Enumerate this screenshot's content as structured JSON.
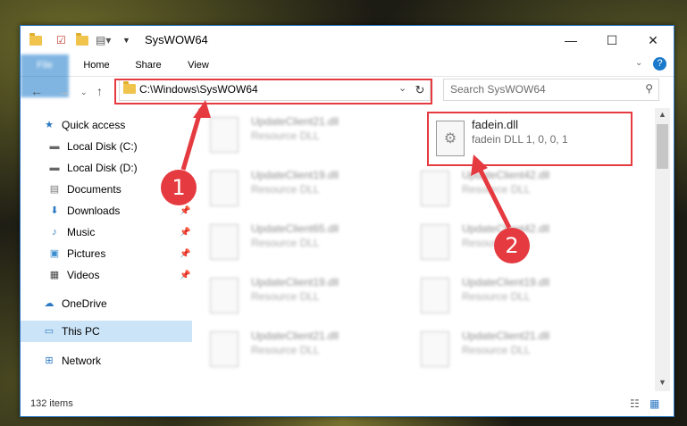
{
  "window": {
    "title": "SysWOW64"
  },
  "ribbon": {
    "tabs": [
      "File",
      "Home",
      "Share",
      "View"
    ]
  },
  "address": {
    "path": "C:\\Windows\\SysWOW64"
  },
  "search": {
    "placeholder": "Search SysWOW64"
  },
  "sidebar": {
    "items": [
      {
        "label": "Quick access",
        "icon": "star-icon",
        "pinned": false
      },
      {
        "label": "Local Disk (C:)",
        "icon": "drive-icon",
        "pinned": false
      },
      {
        "label": "Local Disk (D:)",
        "icon": "drive-icon",
        "pinned": false
      },
      {
        "label": "Documents",
        "icon": "documents-icon",
        "pinned": false
      },
      {
        "label": "Downloads",
        "icon": "download-icon",
        "pinned": true
      },
      {
        "label": "Music",
        "icon": "music-icon",
        "pinned": true
      },
      {
        "label": "Pictures",
        "icon": "pictures-icon",
        "pinned": true
      },
      {
        "label": "Videos",
        "icon": "videos-icon",
        "pinned": true
      },
      {
        "label": "OneDrive",
        "icon": "cloud-icon",
        "pinned": false
      },
      {
        "label": "This PC",
        "icon": "pc-icon",
        "pinned": false,
        "selected": true
      },
      {
        "label": "Network",
        "icon": "network-icon",
        "pinned": false
      }
    ]
  },
  "files": [
    {
      "name": "UpdateClient21.dll",
      "desc": "Resource DLL"
    },
    {
      "name": "UpdateClient19.dll",
      "desc": "Resource DLL"
    },
    {
      "name": "UpdateClient42.dll",
      "desc": "Resource DLL"
    },
    {
      "name": "UpdateClient65.dll",
      "desc": "Resource DLL"
    },
    {
      "name": "UpdateClient42.dll",
      "desc": "Resource DLL"
    },
    {
      "name": "UpdateClient19.dll",
      "desc": "Resource DLL"
    },
    {
      "name": "UpdateClient19.dll",
      "desc": "Resource DLL"
    },
    {
      "name": "UpdateClient21.dll",
      "desc": "Resource DLL"
    },
    {
      "name": "UpdateClient21.dll",
      "desc": "Resource DLL"
    }
  ],
  "selected_file": {
    "name": "fadein.dll",
    "desc": "fadein DLL 1, 0, 0, 1"
  },
  "status": {
    "count": "132 items"
  },
  "markers": [
    "1",
    "2"
  ],
  "colors": {
    "accent": "#1979ca",
    "highlight": "#e53a40"
  }
}
